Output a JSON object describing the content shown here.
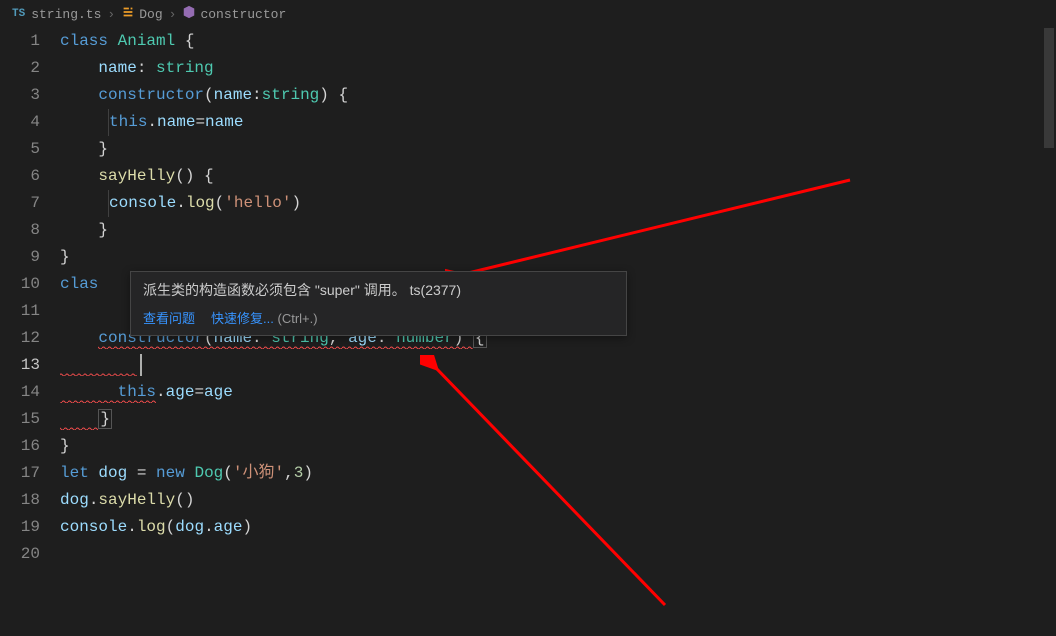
{
  "breadcrumb": {
    "file": "string.ts",
    "class": "Dog",
    "member": "constructor"
  },
  "lines": {
    "count": 20
  },
  "code": {
    "l1": {
      "kw": "class",
      "type": "Aniaml",
      "brace": " {"
    },
    "l2": {
      "var": "name",
      "colon": ": ",
      "typ": "string"
    },
    "l3": {
      "ctor": "constructor",
      "open": "(",
      "param": "name",
      "colon": ":",
      "typ": "string",
      "close": ") {"
    },
    "l4": {
      "thisk": "this",
      "dot": ".",
      "prop": "name",
      "eq": "=",
      "rhs": "name"
    },
    "l5": {
      "brace": "}"
    },
    "l6": {
      "fn": "sayHelly",
      "paren": "() {"
    },
    "l7": {
      "obj": "console",
      "dot": ".",
      "m": "log",
      "open": "(",
      "str": "'hello'",
      "close": ")"
    },
    "l8": {
      "brace": "}"
    },
    "l9": {
      "brace": "}"
    },
    "l10": {
      "kw": "clas"
    },
    "l12": {
      "ctor": "constructor",
      "open": "(",
      "p1": "name",
      "c1": ": ",
      "t1": "string",
      "comma": ", ",
      "p2": "age",
      "c2": ": ",
      "t2": "number",
      "close": ") ",
      "brace": "{"
    },
    "l14": {
      "thisk": "this",
      "dot": ".",
      "prop": "age",
      "eq": "=",
      "rhs": "age"
    },
    "l15": {
      "brace": "}"
    },
    "l16": {
      "brace": "}"
    },
    "l17": {
      "kw": "let",
      "var": "dog",
      "eq": " = ",
      "newk": "new",
      "sp": " ",
      "cls": "Dog",
      "open": "(",
      "str": "'小狗'",
      "comma": ",",
      "num": "3",
      "close": ")"
    },
    "l18": {
      "obj": "dog",
      "dot": ".",
      "m": "sayHelly",
      "paren": "()"
    },
    "l19": {
      "obj": "console",
      "dot": ".",
      "m": "log",
      "open": "(",
      "arg1": "dog",
      "adot": ".",
      "prop": "age",
      "close": ")"
    }
  },
  "tooltip": {
    "message_pre": "派生类的构造函数必须包含 \"",
    "message_kw": "super",
    "message_post": "\" 调用。 ts(2377)",
    "view_problem": "查看问题",
    "quick_fix": "快速修复...",
    "shortcut": "(Ctrl+.)"
  }
}
